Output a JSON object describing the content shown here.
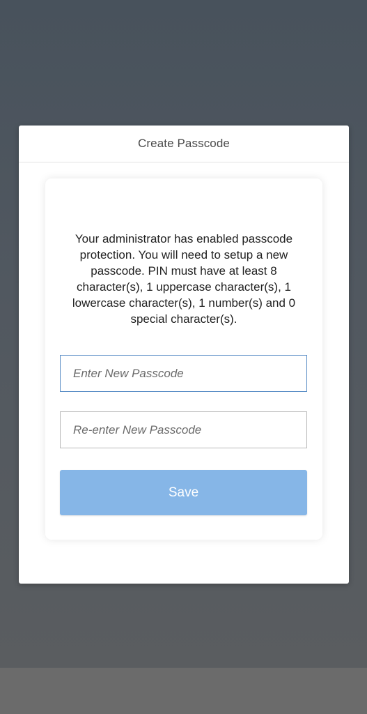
{
  "dialog": {
    "title": "Create Passcode"
  },
  "card": {
    "message": "Your administrator has enabled passcode protection. You will need to setup a new passcode. PIN must have at least 8 character(s), 1 uppercase character(s), 1 lowercase character(s), 1 number(s) and 0 special character(s).",
    "new_passcode": {
      "placeholder": "Enter New Passcode",
      "value": ""
    },
    "confirm_passcode": {
      "placeholder": "Re-enter New Passcode",
      "value": ""
    },
    "save_label": "Save"
  },
  "colors": {
    "accent": "#86b6e7",
    "focus_border": "#5a8ec6"
  }
}
